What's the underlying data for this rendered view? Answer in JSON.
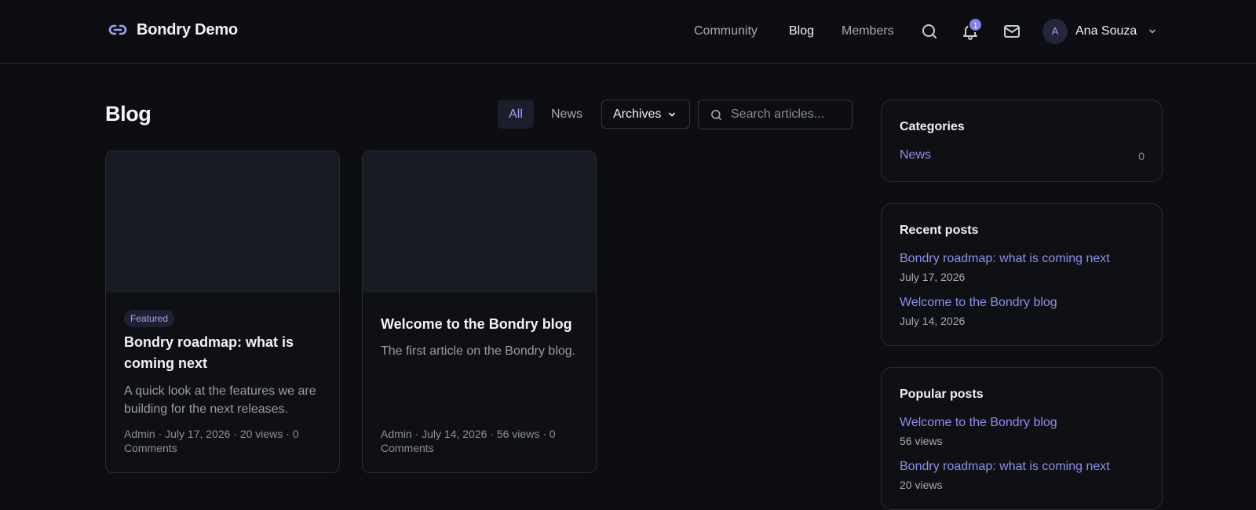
{
  "header": {
    "brand": "Bondry Demo",
    "nav": [
      {
        "label": "Community",
        "active": false
      },
      {
        "label": "Blog",
        "active": true
      },
      {
        "label": "Members",
        "active": false
      }
    ],
    "notifications_count": "1",
    "user": {
      "initial": "A",
      "name": "Ana Souza"
    }
  },
  "main": {
    "title": "Blog",
    "filters": {
      "all": "All",
      "news": "News",
      "archives": "Archives"
    },
    "search": {
      "placeholder": "Search articles..."
    },
    "posts": [
      {
        "badge": "Featured",
        "title": "Bondry roadmap: what is coming next",
        "excerpt": "A quick look at the features we are building for the next releases.",
        "meta": "Admin · July 17, 2026 · 20 views · 0 Comments"
      },
      {
        "badge": "",
        "title": "Welcome to the Bondry blog",
        "excerpt": "The first article on the Bondry blog.",
        "meta": "Admin · July 14, 2026 · 56 views · 0 Comments"
      }
    ]
  },
  "sidebar": {
    "categories": {
      "title": "Categories",
      "items": [
        {
          "label": "News",
          "count": "0"
        }
      ]
    },
    "recent": {
      "title": "Recent posts",
      "items": [
        {
          "label": "Bondry roadmap: what is coming next",
          "sub": "July 17, 2026"
        },
        {
          "label": "Welcome to the Bondry blog",
          "sub": "July 14, 2026"
        }
      ]
    },
    "popular": {
      "title": "Popular posts",
      "items": [
        {
          "label": "Welcome to the Bondry blog",
          "sub": "56 views"
        },
        {
          "label": "Bondry roadmap: what is coming next",
          "sub": "20 views"
        }
      ]
    }
  },
  "colors": {
    "background": "#0d0e12",
    "accent": "#8b8ff0",
    "card": "#0f1014"
  }
}
